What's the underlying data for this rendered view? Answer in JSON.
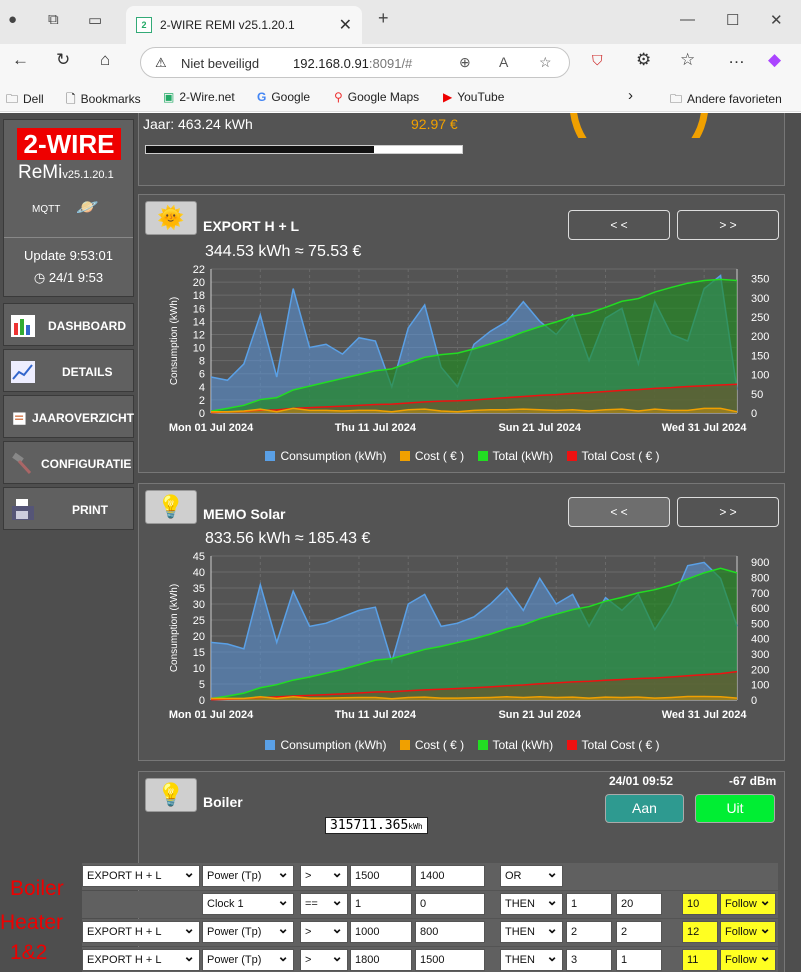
{
  "browser": {
    "tab_title": "2-WIRE REMI v25.1.20.1",
    "favicon_text": "2",
    "address_warning": "Niet beveiligd",
    "url_host": "192.168.0.91",
    "url_rest": ":8091/#",
    "bookmarks": [
      {
        "label": "Dell",
        "icon": "folder-icon"
      },
      {
        "label": "Bookmarks",
        "icon": "page-icon"
      },
      {
        "label": "2-Wire.net",
        "icon": "site-icon"
      },
      {
        "label": "Google",
        "icon": "google-icon"
      },
      {
        "label": "Google Maps",
        "icon": "maps-icon"
      },
      {
        "label": "YouTube",
        "icon": "youtube-icon"
      }
    ],
    "other_favorites": "Andere favorieten"
  },
  "sidebar": {
    "logo": "2-WIRE",
    "product": "ReMi",
    "version": "v25.1.20.1",
    "mqtt": "MQTT",
    "update": "Update 9:53:01",
    "clock": "24/1   9:53",
    "nav": [
      {
        "label": "DASHBOARD",
        "icon": "dashboard-icon"
      },
      {
        "label": "DETAILS",
        "icon": "chart-icon"
      },
      {
        "label": "JAAROVERZICHT",
        "icon": "report-icon"
      },
      {
        "label": "CONFIGURATIE",
        "icon": "hammer-icon"
      },
      {
        "label": "PRINT",
        "icon": "printer-icon"
      }
    ]
  },
  "top_panel": {
    "year_label": "Jaar: 463.24 kWh",
    "year_cost": "92.97 €",
    "progress_fraction": 0.72
  },
  "legend": [
    "Consumption (kWh)",
    "Cost ( € )",
    "Total (kWh)",
    "Total Cost ( € )"
  ],
  "colors": {
    "consumption": "#5aa0e6",
    "cost": "#f0a000",
    "total": "#22dd22",
    "total_cost": "#ee1111",
    "green_button": "#00ee33",
    "teal_button": "#2e9a90",
    "highlight": "#ffff22",
    "red_label": "#ee0000"
  },
  "panels": [
    {
      "title": "EXPORT H + L",
      "summary": "344.53 kWh ≈ 75.53 €",
      "prev": "< <",
      "next": "> >",
      "prev_active": false
    },
    {
      "title": "MEMO Solar",
      "summary": "833.56 kWh ≈ 185.43 €",
      "prev": "< <",
      "next": "> >",
      "prev_active": true
    }
  ],
  "chart_data": [
    {
      "type": "area",
      "ylabel": "Consumption (kWh)",
      "xlabels": [
        "Mon 01 Jul 2024",
        "Thu 11 Jul 2024",
        "Sun 21 Jul 2024",
        "Wed 31 Jul 2024"
      ],
      "ylim": [
        0,
        22
      ],
      "yticks": [
        0,
        2,
        4,
        6,
        8,
        10,
        12,
        14,
        16,
        18,
        20,
        22
      ],
      "y2lim": [
        0,
        375
      ],
      "y2ticks": [
        0,
        50,
        100,
        150,
        200,
        250,
        300,
        350
      ],
      "series": [
        {
          "name": "Consumption (kWh)",
          "axis": "left",
          "values": [
            5.5,
            5,
            7.5,
            15,
            5.5,
            19,
            10,
            10.5,
            9,
            11.5,
            11,
            4,
            13,
            16.5,
            7,
            4,
            10.5,
            12.5,
            14,
            17,
            14,
            12,
            15,
            8,
            14.5,
            16,
            7.5,
            17,
            12,
            11,
            19,
            21,
            3.5
          ]
        },
        {
          "name": "Cost ( € )",
          "axis": "left",
          "values": [
            0.2,
            0.2,
            0.3,
            0.6,
            0.2,
            0.7,
            0.4,
            0.4,
            0.3,
            0.4,
            0.4,
            0.2,
            0.5,
            0.6,
            0.3,
            0.2,
            0.4,
            0.5,
            0.5,
            0.6,
            0.5,
            0.4,
            0.5,
            0.3,
            0.5,
            0.6,
            0.3,
            0.6,
            0.4,
            0.4,
            0.7,
            0.7,
            0.2
          ]
        },
        {
          "name": "Total (kWh)",
          "axis": "right",
          "values": [
            5,
            12,
            20,
            35,
            40,
            60,
            70,
            80,
            90,
            100,
            110,
            115,
            130,
            145,
            152,
            156,
            167,
            180,
            194,
            211,
            225,
            237,
            252,
            260,
            275,
            291,
            298,
            315,
            327,
            338,
            345,
            348,
            345
          ]
        },
        {
          "name": "Total Cost ( € )",
          "axis": "right",
          "values": [
            1,
            3,
            4,
            7,
            8,
            12,
            14,
            16,
            18,
            20,
            22,
            23,
            26,
            29,
            31,
            32,
            34,
            37,
            40,
            43,
            46,
            48,
            51,
            53,
            56,
            59,
            61,
            64,
            66,
            69,
            71,
            73,
            75
          ]
        }
      ]
    },
    {
      "type": "area",
      "ylabel": "Consumption (kWh)",
      "xlabels": [
        "Mon 01 Jul 2024",
        "Thu 11 Jul 2024",
        "Sun 21 Jul 2024",
        "Wed 31 Jul 2024"
      ],
      "ylim": [
        0,
        45
      ],
      "yticks": [
        0,
        5,
        10,
        15,
        20,
        25,
        30,
        35,
        40,
        45
      ],
      "y2lim": [
        0,
        940
      ],
      "y2ticks": [
        0,
        100,
        200,
        300,
        400,
        500,
        600,
        700,
        800,
        900
      ],
      "series": [
        {
          "name": "Consumption (kWh)",
          "axis": "left",
          "values": [
            18,
            17.5,
            16,
            36,
            18,
            34,
            23,
            24,
            26,
            28,
            29,
            12,
            30,
            33,
            23,
            24,
            26,
            30,
            35,
            28,
            38,
            30,
            33,
            23,
            32,
            28,
            33,
            22,
            30,
            42,
            43,
            38,
            23
          ]
        },
        {
          "name": "Cost ( € )",
          "axis": "left",
          "values": [
            0.5,
            0.5,
            0.5,
            1,
            0.5,
            1,
            0.6,
            0.6,
            0.7,
            0.8,
            0.8,
            0.4,
            0.8,
            0.9,
            0.6,
            0.6,
            0.7,
            0.8,
            1,
            0.8,
            1,
            0.8,
            0.9,
            0.6,
            0.9,
            0.8,
            0.9,
            0.6,
            0.8,
            1.1,
            1.1,
            1,
            0.6
          ]
        },
        {
          "name": "Total (kWh)",
          "axis": "right",
          "values": [
            10,
            25,
            45,
            80,
            100,
            130,
            150,
            175,
            200,
            230,
            260,
            270,
            300,
            330,
            350,
            375,
            400,
            430,
            465,
            490,
            530,
            560,
            590,
            610,
            645,
            670,
            700,
            720,
            750,
            790,
            830,
            860,
            830
          ]
        },
        {
          "name": "Total Cost ( € )",
          "axis": "right",
          "values": [
            2,
            5,
            9,
            16,
            20,
            26,
            30,
            35,
            40,
            46,
            52,
            54,
            60,
            66,
            70,
            75,
            80,
            86,
            93,
            98,
            106,
            112,
            118,
            122,
            129,
            134,
            140,
            144,
            150,
            158,
            166,
            172,
            185
          ]
        }
      ]
    }
  ],
  "boiler": {
    "title": "Boiler",
    "timestamp": "24/01 09:52",
    "signal": "-67 dBm",
    "meter": "315711.365",
    "meter_unit": "kWh",
    "on_label": "Aan",
    "off_label": "Uit",
    "side_labels": [
      "Boiler",
      "Heater",
      "1&2"
    ],
    "rules": [
      {
        "source": "EXPORT H + L",
        "metric": "Power (Tp)",
        "op": ">",
        "v1": "1500",
        "v2": "1400",
        "logic": "OR",
        "a": "",
        "b": "",
        "out": "",
        "mode": ""
      },
      {
        "source": "",
        "metric": "Clock 1",
        "op": "==",
        "v1": "1",
        "v2": "0",
        "logic": "THEN",
        "a": "1",
        "b": "20",
        "out": "10",
        "mode": "Follow"
      },
      {
        "source": "EXPORT H + L",
        "metric": "Power (Tp)",
        "op": ">",
        "v1": "1000",
        "v2": "800",
        "logic": "THEN",
        "a": "2",
        "b": "2",
        "out": "12",
        "mode": "Follow"
      },
      {
        "source": "EXPORT H + L",
        "metric": "Power (Tp)",
        "op": ">",
        "v1": "1800",
        "v2": "1500",
        "logic": "THEN",
        "a": "3",
        "b": "1",
        "out": "11",
        "mode": "Follow"
      }
    ]
  }
}
